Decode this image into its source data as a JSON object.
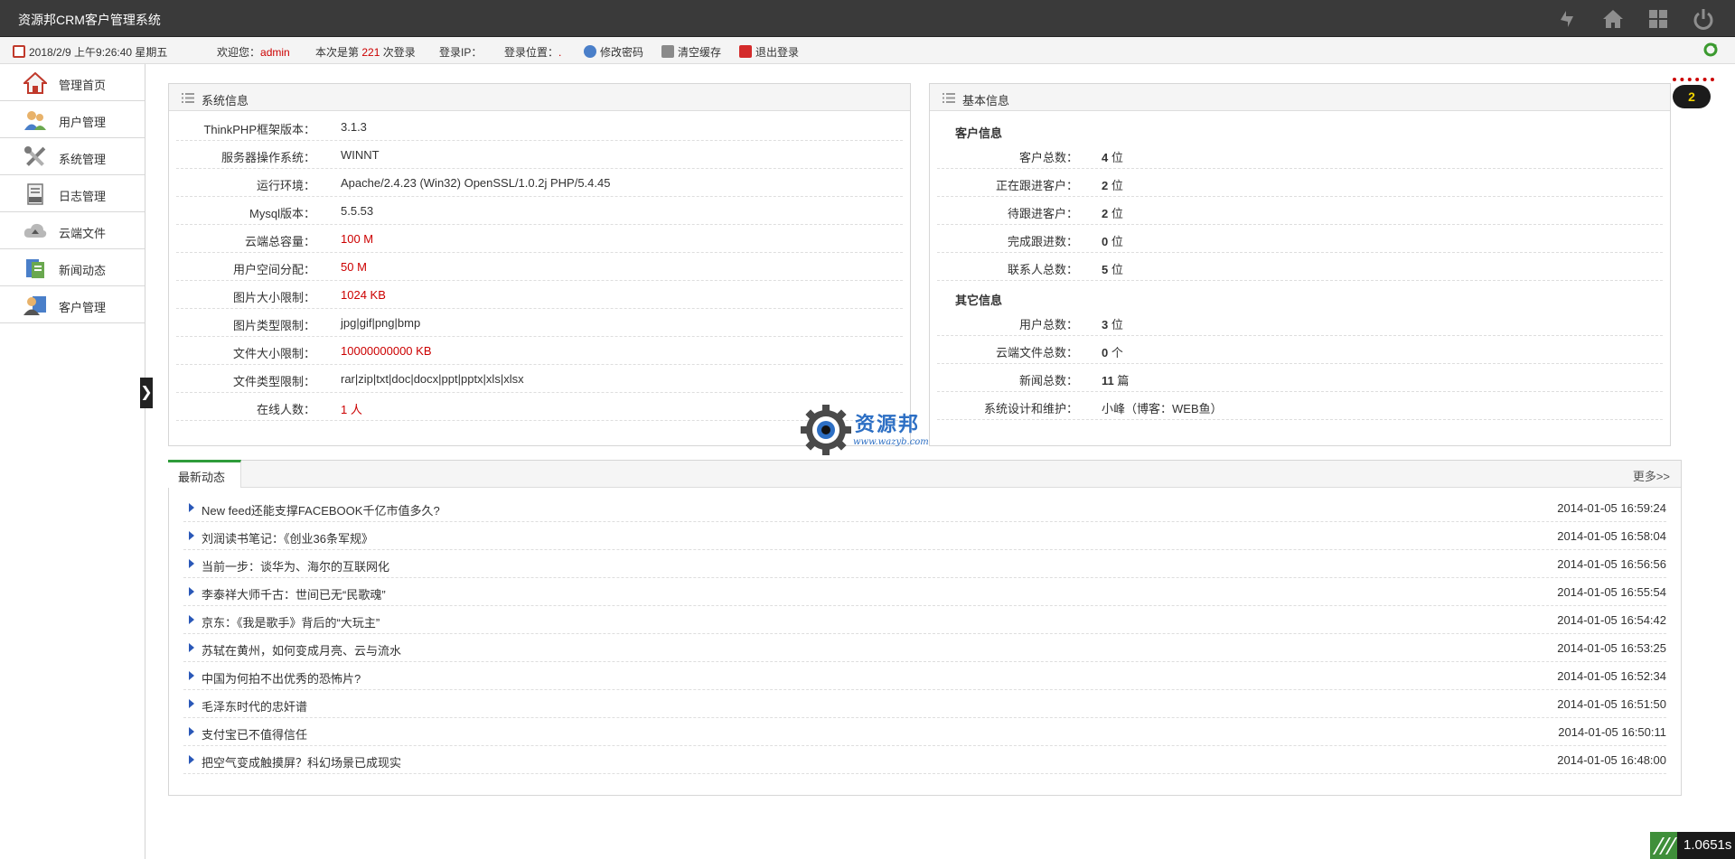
{
  "app": {
    "title": "资源邦CRM客户管理系统"
  },
  "topbar": {
    "icons": [
      "refresh-icon",
      "home-icon",
      "grid-icon",
      "power-icon"
    ]
  },
  "infobar": {
    "datetime": "2018/2/9 上午9:26:40 星期五",
    "welcome_label": "欢迎您：",
    "username": "admin",
    "login_count_prefix": "本次是第",
    "login_count": "221",
    "login_count_suffix": "次登录",
    "login_ip_label": "登录IP：",
    "login_location_label": "登录位置：",
    "login_location_value": ".",
    "change_password": "修改密码",
    "clear_cache": "清空缓存",
    "logout": "退出登录"
  },
  "sidebar": {
    "items": [
      {
        "label": "管理首页",
        "icon": "home-icon"
      },
      {
        "label": "用户管理",
        "icon": "users-icon"
      },
      {
        "label": "系统管理",
        "icon": "tools-icon"
      },
      {
        "label": "日志管理",
        "icon": "log-icon"
      },
      {
        "label": "云端文件",
        "icon": "cloud-icon"
      },
      {
        "label": "新闻动态",
        "icon": "news-icon"
      },
      {
        "label": "客户管理",
        "icon": "customer-icon"
      }
    ],
    "collapse_glyph": "❯"
  },
  "system_info": {
    "title": "系统信息",
    "rows": [
      {
        "key": "ThinkPHP框架版本：",
        "value": "3.1.3"
      },
      {
        "key": "服务器操作系统：",
        "value": "WINNT"
      },
      {
        "key": "运行环境：",
        "value": "Apache/2.4.23 (Win32) OpenSSL/1.0.2j PHP/5.4.45"
      },
      {
        "key": "Mysql版本：",
        "value": "5.5.53"
      },
      {
        "key": "云端总容量：",
        "value": "100 M"
      },
      {
        "key": "用户空间分配：",
        "value": "50 M"
      },
      {
        "key": "图片大小限制：",
        "value": "1024 KB"
      },
      {
        "key": "图片类型限制：",
        "value": "jpg|gif|png|bmp"
      },
      {
        "key": "文件大小限制：",
        "value": "10000000000 KB"
      },
      {
        "key": "文件类型限制：",
        "value": "rar|zip|txt|doc|docx|ppt|pptx|xls|xlsx"
      },
      {
        "key": "在线人数：",
        "value": "1 人"
      }
    ]
  },
  "basic_info": {
    "title": "基本信息",
    "customer_section": "客户信息",
    "customer_rows": [
      {
        "key": "客户总数：",
        "num": "4",
        "unit": "位"
      },
      {
        "key": "正在跟进客户：",
        "num": "2",
        "unit": "位"
      },
      {
        "key": "待跟进客户：",
        "num": "2",
        "unit": "位"
      },
      {
        "key": "完成跟进数：",
        "num": "0",
        "unit": "位"
      },
      {
        "key": "联系人总数：",
        "num": "5",
        "unit": "位"
      }
    ],
    "other_section": "其它信息",
    "other_rows": [
      {
        "key": "用户总数：",
        "num": "3",
        "unit": "位"
      },
      {
        "key": "云端文件总数：",
        "num": "0",
        "unit": "个"
      },
      {
        "key": "新闻总数：",
        "num": "11",
        "unit": "篇"
      },
      {
        "key": "系统设计和维护：",
        "value": "小峰（博客：WEB鱼）"
      }
    ]
  },
  "news": {
    "tab_label": "最新动态",
    "more_label": "更多>>",
    "items": [
      {
        "title": "New feed还能支撑FACEBOOK千亿市值多久?",
        "date": "2014-01-05 16:59:24"
      },
      {
        "title": "刘润读书笔记：《创业36条军规》",
        "date": "2014-01-05 16:58:04"
      },
      {
        "title": "当前一步：谈华为、海尔的互联网化",
        "date": "2014-01-05 16:56:56"
      },
      {
        "title": "李泰祥大师千古：世间已无“民歌魂”",
        "date": "2014-01-05 16:55:54"
      },
      {
        "title": "京东：《我是歌手》背后的“大玩主”",
        "date": "2014-01-05 16:54:42"
      },
      {
        "title": "苏轼在黄州，如何变成月亮、云与流水",
        "date": "2014-01-05 16:53:25"
      },
      {
        "title": "中国为何拍不出优秀的恐怖片?",
        "date": "2014-01-05 16:52:34"
      },
      {
        "title": "毛泽东时代的忠奸谱",
        "date": "2014-01-05 16:51:50"
      },
      {
        "title": "支付宝已不值得信任",
        "date": "2014-01-05 16:50:11"
      },
      {
        "title": "把空气变成触摸屏？科幻场景已成现实",
        "date": "2014-01-05 16:48:00"
      }
    ]
  },
  "watermark": {
    "text": "资源邦",
    "url": "www.wazyb.com"
  },
  "notification": {
    "count": "2"
  },
  "timer": {
    "value": "1.0651s"
  },
  "colors": {
    "topbar": "#3a3a3a",
    "accent_red": "#cc0000",
    "tab_green": "#2e9c3a",
    "arrow_blue": "#2a58b8"
  }
}
